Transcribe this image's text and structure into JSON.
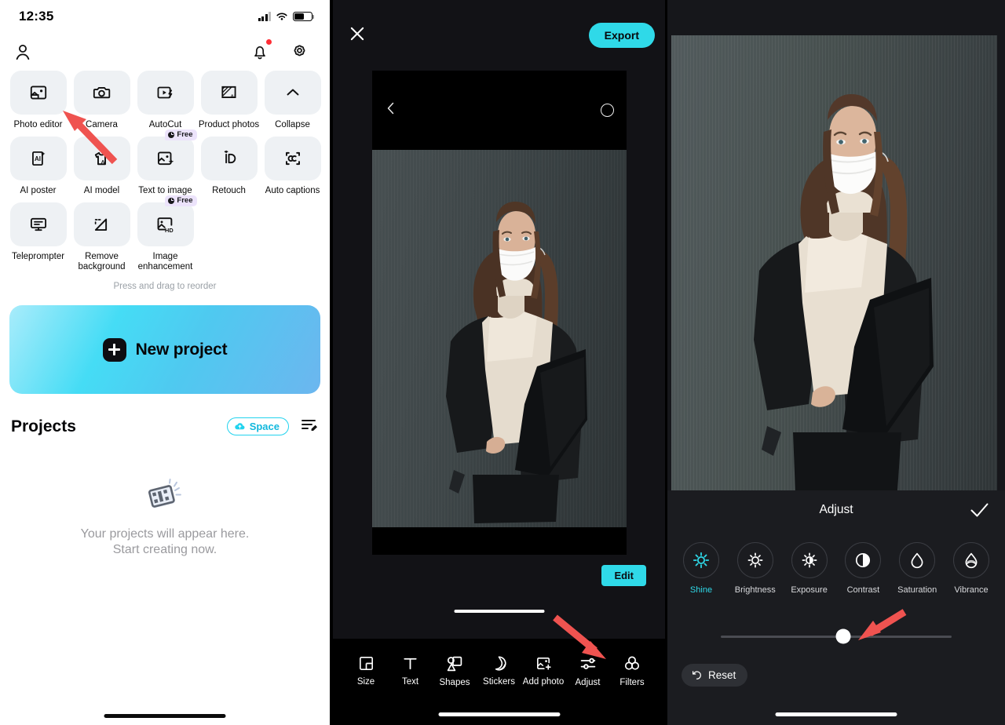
{
  "home": {
    "status": {
      "time": "12:35",
      "signal_icon": "signal-bars-icon",
      "wifi_icon": "wifi-icon",
      "battery_icon": "battery-icon"
    },
    "topbar": {
      "profile_icon": "profile-icon",
      "notifications_icon": "bell-icon",
      "settings_icon": "gear-icon"
    },
    "tools_row1": [
      {
        "label": "Photo editor",
        "icon": "photo-editor-icon",
        "badge": ""
      },
      {
        "label": "Camera",
        "icon": "camera-icon",
        "badge": ""
      },
      {
        "label": "AutoCut",
        "icon": "autocut-icon",
        "badge": ""
      },
      {
        "label": "Product photos",
        "icon": "product-photos-icon",
        "badge": ""
      },
      {
        "label": "Collapse",
        "icon": "chevron-up-icon",
        "badge": ""
      }
    ],
    "tools_row2": [
      {
        "label": "AI poster",
        "icon": "ai-poster-icon",
        "badge": ""
      },
      {
        "label": "AI model",
        "icon": "ai-model-icon",
        "badge": ""
      },
      {
        "label": "Text to image",
        "icon": "text-to-image-icon",
        "badge": "Free"
      },
      {
        "label": "Retouch",
        "icon": "retouch-icon",
        "badge": ""
      },
      {
        "label": "Auto captions",
        "icon": "auto-captions-icon",
        "badge": ""
      }
    ],
    "tools_row3": [
      {
        "label": "Teleprompter",
        "icon": "teleprompter-icon",
        "badge": ""
      },
      {
        "label": "Remove background",
        "icon": "remove-background-icon",
        "badge": ""
      },
      {
        "label": "Image enhancement",
        "icon": "image-enhancement-icon",
        "badge": "Free"
      }
    ],
    "reorder_hint": "Press and drag to reorder",
    "new_project": {
      "label": "New project",
      "icon": "plus-icon"
    },
    "projects": {
      "title": "Projects",
      "space_label": "Space",
      "space_icon": "cloud-upload-icon",
      "sort_icon": "sort-edit-icon",
      "empty_icon": "film-clip-icon",
      "empty_line1": "Your projects will appear here.",
      "empty_line2": "Start creating now."
    }
  },
  "editor": {
    "close_icon": "close-icon",
    "export_label": "Export",
    "canvas": {
      "back_icon": "chevron-left-icon",
      "record_icon": "circle-icon"
    },
    "edit_label": "Edit",
    "toolbar": [
      {
        "label": "Size",
        "icon": "size-icon"
      },
      {
        "label": "Text",
        "icon": "text-icon"
      },
      {
        "label": "Shapes",
        "icon": "shapes-icon"
      },
      {
        "label": "Stickers",
        "icon": "stickers-icon"
      },
      {
        "label": "Add photo",
        "icon": "add-photo-icon"
      },
      {
        "label": "Adjust",
        "icon": "adjust-icon"
      },
      {
        "label": "Filters",
        "icon": "filters-icon"
      }
    ]
  },
  "adjust": {
    "title": "Adjust",
    "confirm_icon": "check-icon",
    "items": [
      {
        "label": "Shine",
        "icon": "shine-icon",
        "active": true
      },
      {
        "label": "Brightness",
        "icon": "brightness-icon",
        "active": false
      },
      {
        "label": "Exposure",
        "icon": "exposure-icon",
        "active": false
      },
      {
        "label": "Contrast",
        "icon": "contrast-icon",
        "active": false
      },
      {
        "label": "Saturation",
        "icon": "saturation-icon",
        "active": false
      },
      {
        "label": "Vibrance",
        "icon": "vibrance-icon",
        "active": false
      }
    ],
    "slider": {
      "value_percent": 53
    },
    "reset_label": "Reset",
    "reset_icon": "undo-icon"
  },
  "annotations": {
    "arrow_color": "#ef5350",
    "arrows": [
      {
        "name": "arrow-to-photo-editor"
      },
      {
        "name": "arrow-to-adjust-tool"
      },
      {
        "name": "arrow-to-slider-knob"
      }
    ]
  },
  "colors": {
    "accent_cyan": "#2fd9e8",
    "tile_gray": "#eef1f4",
    "badge_purple": "#ece3fb",
    "notification_red": "#ff2d35",
    "dark_bg": "#16171b"
  }
}
